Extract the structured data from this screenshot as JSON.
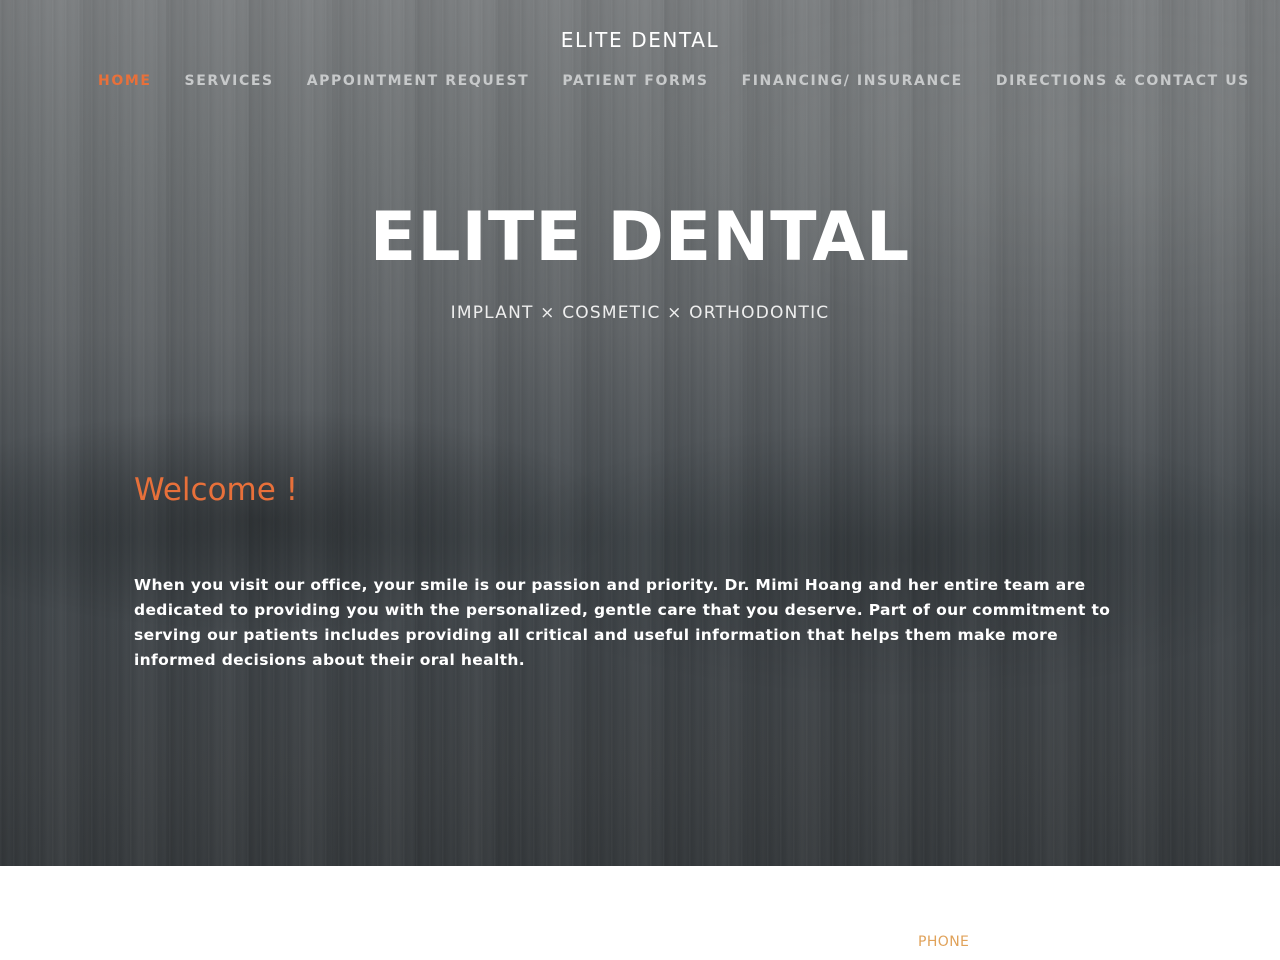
{
  "header": {
    "site_title": "ELITE DENTAL"
  },
  "nav": {
    "items": [
      {
        "label": "HOME",
        "active": true
      },
      {
        "label": "SERVICES",
        "active": false
      },
      {
        "label": "APPOINTMENT REQUEST",
        "active": false
      },
      {
        "label": "PATIENT FORMS",
        "active": false
      },
      {
        "label": "FINANCING/ INSURANCE",
        "active": false
      },
      {
        "label": "DIRECTIONS & CONTACT US",
        "active": false
      }
    ]
  },
  "hero": {
    "heading": "ELITE DENTAL",
    "tagline": "IMPLANT × COSMETIC × ORTHODONTIC"
  },
  "main": {
    "welcome": "Welcome !",
    "intro": "When you visit our office, your smile is our passion and priority.  Dr. Mimi Hoang and her entire team are dedicated to providing you with the personalized, gentle care that you deserve.  Part of our commitment to serving our patients includes providing all critical and useful information that helps them make more informed decisions about their oral health."
  },
  "footer": {
    "phone_label": "PHONE"
  },
  "colors": {
    "accent": "#e8703a",
    "phone_label": "#e0a25a",
    "hero_text": "#ffffff"
  }
}
